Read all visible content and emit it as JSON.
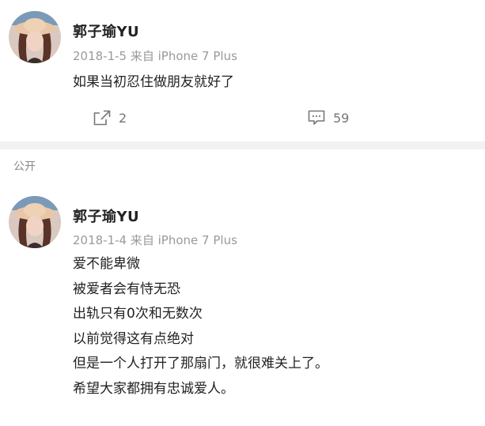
{
  "posts": [
    {
      "username": "郭子瑜YU",
      "date": "2018-1-5",
      "source": "来自 iPhone 7 Plus",
      "content_lines": [
        "如果当初忍住做朋友就好了"
      ],
      "share_count": "2",
      "comment_count": "59"
    },
    {
      "username": "郭子瑜YU",
      "date": "2018-1-4",
      "source": "来自 iPhone 7 Plus",
      "content_lines": [
        "爱不能卑微",
        "被爱者会有恃无恐",
        "出轨只有0次和无数次",
        "以前觉得这有点绝对",
        "但是一个人打开了那扇门，就很难关上了。",
        "希望大家都拥有忠诚爱人。"
      ]
    }
  ],
  "visibility_label": "公开",
  "icons": {
    "share": "share-icon",
    "comment": "comment-icon"
  },
  "colors": {
    "username": "#222222",
    "meta": "#9a9a9a",
    "divider": "#f2f2f2"
  }
}
